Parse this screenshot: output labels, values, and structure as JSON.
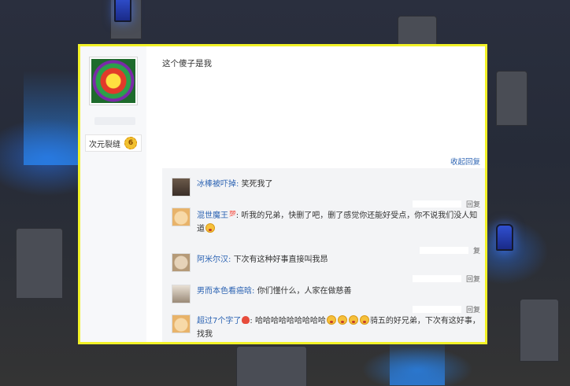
{
  "post": {
    "text": "这个傻子是我",
    "author_level": {
      "title": "次元裂缝",
      "level": "6"
    },
    "collapse_label": "收起回复"
  },
  "replies": [
    {
      "user": "冰棒被吓掉:",
      "text": "笑死我了",
      "reply_label": "回复",
      "avatar_icon": "dark-figure-avatar"
    },
    {
      "user": "混世魔王",
      "user_icon": "100-icon",
      "text": "听我的兄弟，快删了吧，删了感觉你还能好受点，你不说我们没人知道",
      "trailing_emoji": "grin-emoji",
      "reply_label": "复",
      "avatar_icon": "cartoon-cat-avatar"
    },
    {
      "user": "阿米尔汉:",
      "text": "下次有这种好事直接叫我昂",
      "reply_label": "回复",
      "avatar_icon": "cat-avatar"
    },
    {
      "user": "男而本色看癌晗:",
      "text": "你们懂什么，人家在做慈善",
      "reply_label": "回复",
      "avatar_icon": "person-avatar"
    },
    {
      "user": "超过7个字了",
      "user_icon": "fire-icon",
      "text_before": "哈哈哈哈哈哈哈哈哈",
      "text_after": "骑五的好兄弟，下次有这好事，找我",
      "emoji_count": 4,
      "avatar_icon": "cartoon-cat-avatar"
    }
  ]
}
